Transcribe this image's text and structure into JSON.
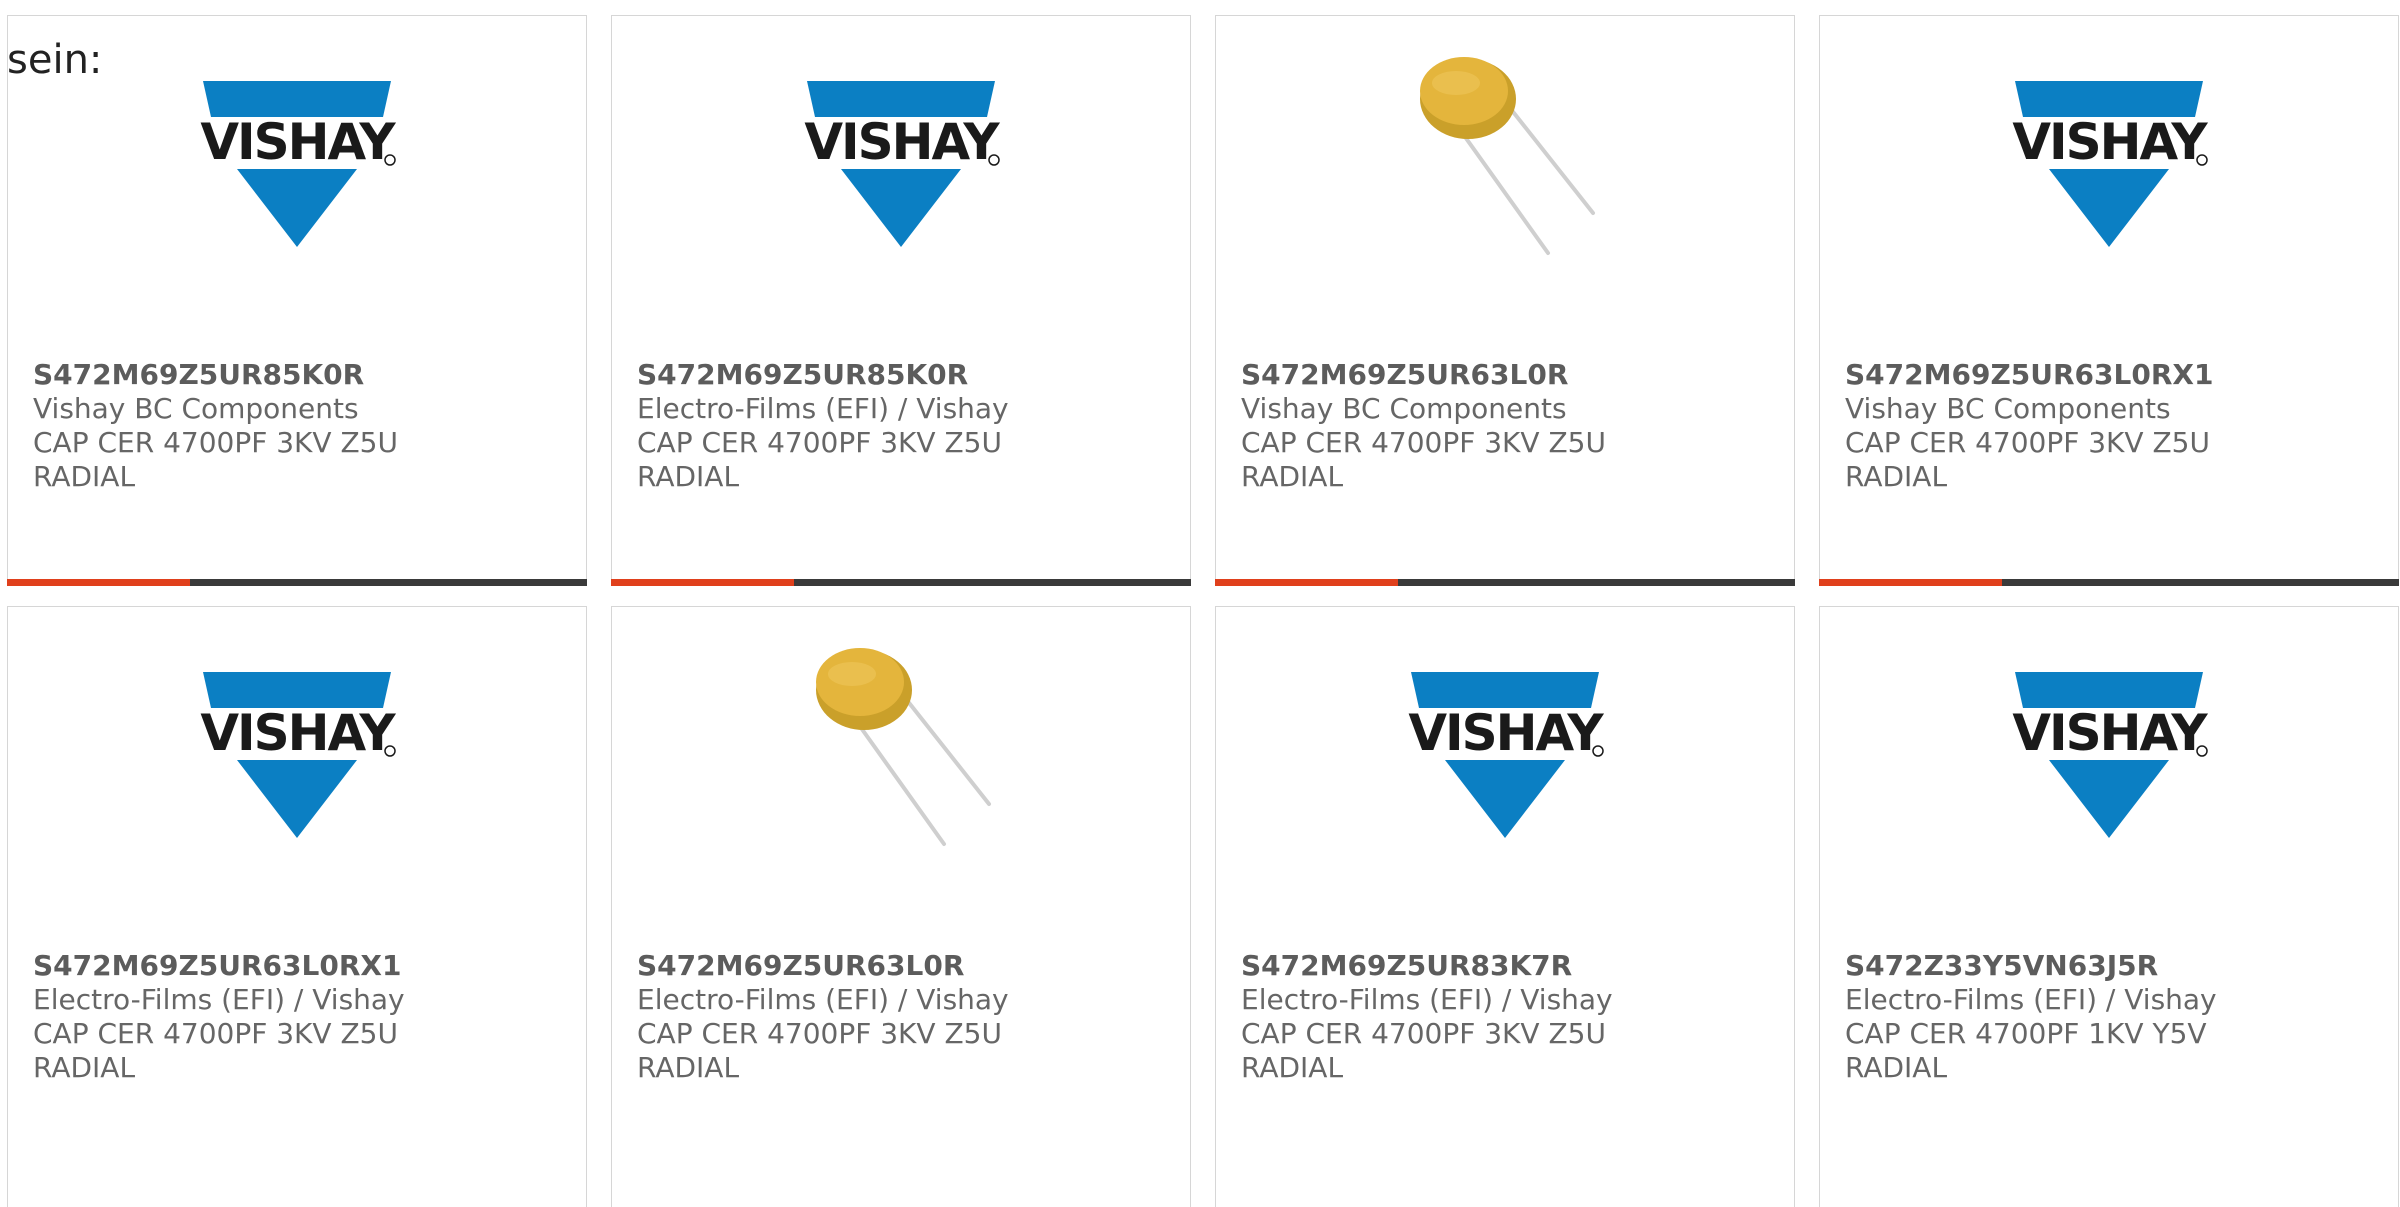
{
  "intro_text": "sein:",
  "colors": {
    "vishay_blue": "#0b7fc3",
    "accent_bar": "#e0401c",
    "dark_bar": "#3a3a3a"
  },
  "cards": [
    {
      "image": "vishay-logo",
      "part_number": "S472M69Z5UR85K0R",
      "manufacturer": "Vishay BC Components",
      "desc_line1": "CAP CER 4700PF 3KV Z5U",
      "desc_line2": "RADIAL"
    },
    {
      "image": "vishay-logo",
      "part_number": "S472M69Z5UR85K0R",
      "manufacturer": "Electro-Films (EFI) / Vishay",
      "desc_line1": "CAP CER 4700PF 3KV Z5U",
      "desc_line2": "RADIAL"
    },
    {
      "image": "capacitor-photo",
      "part_number": "S472M69Z5UR63L0R",
      "manufacturer": "Vishay BC Components",
      "desc_line1": "CAP CER 4700PF 3KV Z5U",
      "desc_line2": "RADIAL"
    },
    {
      "image": "vishay-logo",
      "part_number": "S472M69Z5UR63L0RX1",
      "manufacturer": "Vishay BC Components",
      "desc_line1": "CAP CER 4700PF 3KV Z5U",
      "desc_line2": "RADIAL"
    },
    {
      "image": "vishay-logo",
      "part_number": "S472M69Z5UR63L0RX1",
      "manufacturer": "Electro-Films (EFI) / Vishay",
      "desc_line1": "CAP CER 4700PF 3KV Z5U",
      "desc_line2": "RADIAL"
    },
    {
      "image": "capacitor-photo",
      "part_number": "S472M69Z5UR63L0R",
      "manufacturer": "Electro-Films (EFI) / Vishay",
      "desc_line1": "CAP CER 4700PF 3KV Z5U",
      "desc_line2": "RADIAL"
    },
    {
      "image": "vishay-logo",
      "part_number": "S472M69Z5UR83K7R",
      "manufacturer": "Electro-Films (EFI) / Vishay",
      "desc_line1": "CAP CER 4700PF 3KV Z5U",
      "desc_line2": "RADIAL"
    },
    {
      "image": "vishay-logo",
      "part_number": "S472Z33Y5VN63J5R",
      "manufacturer": "Electro-Films (EFI) / Vishay",
      "desc_line1": "CAP CER 4700PF 1KV Y5V",
      "desc_line2": "RADIAL"
    }
  ],
  "vishay_logo_text": "VISHAY"
}
